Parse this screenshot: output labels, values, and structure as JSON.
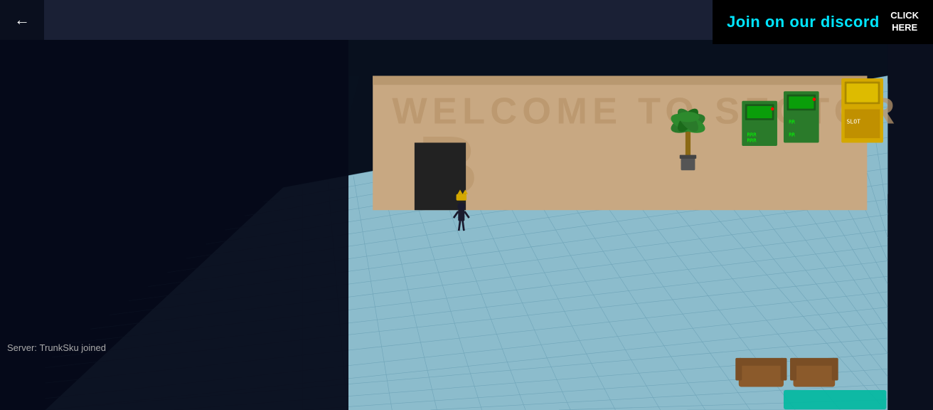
{
  "topbar": {
    "back_label": "←",
    "search_placeholder": ""
  },
  "discord": {
    "join_text": "Join on our discord",
    "click_text": "CLICK\nHERE"
  },
  "chat": {
    "server_label": "Server:",
    "server_message": "TrunkSku joined"
  },
  "wall": {
    "top_text": "WELCOME TO SECTOR",
    "sector_letter": "B"
  },
  "colors": {
    "bg_dark": "#08101e",
    "floor_color": "#8fb8c8",
    "wall_color": "#c8a882",
    "accent_cyan": "#00e5ff",
    "machine_green": "#2d8a2d",
    "machine_yellow": "#d4a800"
  }
}
